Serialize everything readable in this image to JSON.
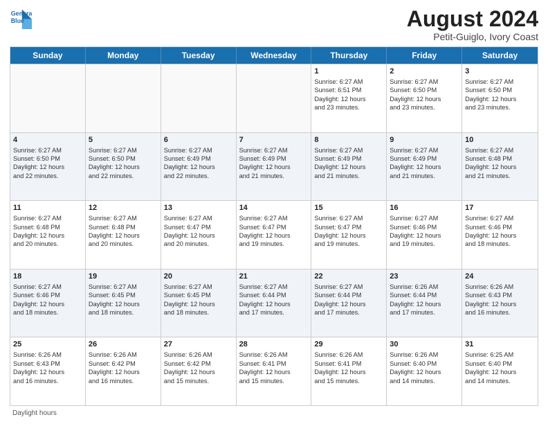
{
  "logo": {
    "line1": "General",
    "line2": "Blue"
  },
  "title": "August 2024",
  "subtitle": "Petit-Guiglo, Ivory Coast",
  "days_of_week": [
    "Sunday",
    "Monday",
    "Tuesday",
    "Wednesday",
    "Thursday",
    "Friday",
    "Saturday"
  ],
  "weeks": [
    [
      {
        "day": "",
        "info": ""
      },
      {
        "day": "",
        "info": ""
      },
      {
        "day": "",
        "info": ""
      },
      {
        "day": "",
        "info": ""
      },
      {
        "day": "1",
        "info": "Sunrise: 6:27 AM\nSunset: 6:51 PM\nDaylight: 12 hours\nand 23 minutes."
      },
      {
        "day": "2",
        "info": "Sunrise: 6:27 AM\nSunset: 6:50 PM\nDaylight: 12 hours\nand 23 minutes."
      },
      {
        "day": "3",
        "info": "Sunrise: 6:27 AM\nSunset: 6:50 PM\nDaylight: 12 hours\nand 23 minutes."
      }
    ],
    [
      {
        "day": "4",
        "info": "Sunrise: 6:27 AM\nSunset: 6:50 PM\nDaylight: 12 hours\nand 22 minutes."
      },
      {
        "day": "5",
        "info": "Sunrise: 6:27 AM\nSunset: 6:50 PM\nDaylight: 12 hours\nand 22 minutes."
      },
      {
        "day": "6",
        "info": "Sunrise: 6:27 AM\nSunset: 6:49 PM\nDaylight: 12 hours\nand 22 minutes."
      },
      {
        "day": "7",
        "info": "Sunrise: 6:27 AM\nSunset: 6:49 PM\nDaylight: 12 hours\nand 21 minutes."
      },
      {
        "day": "8",
        "info": "Sunrise: 6:27 AM\nSunset: 6:49 PM\nDaylight: 12 hours\nand 21 minutes."
      },
      {
        "day": "9",
        "info": "Sunrise: 6:27 AM\nSunset: 6:49 PM\nDaylight: 12 hours\nand 21 minutes."
      },
      {
        "day": "10",
        "info": "Sunrise: 6:27 AM\nSunset: 6:48 PM\nDaylight: 12 hours\nand 21 minutes."
      }
    ],
    [
      {
        "day": "11",
        "info": "Sunrise: 6:27 AM\nSunset: 6:48 PM\nDaylight: 12 hours\nand 20 minutes."
      },
      {
        "day": "12",
        "info": "Sunrise: 6:27 AM\nSunset: 6:48 PM\nDaylight: 12 hours\nand 20 minutes."
      },
      {
        "day": "13",
        "info": "Sunrise: 6:27 AM\nSunset: 6:47 PM\nDaylight: 12 hours\nand 20 minutes."
      },
      {
        "day": "14",
        "info": "Sunrise: 6:27 AM\nSunset: 6:47 PM\nDaylight: 12 hours\nand 19 minutes."
      },
      {
        "day": "15",
        "info": "Sunrise: 6:27 AM\nSunset: 6:47 PM\nDaylight: 12 hours\nand 19 minutes."
      },
      {
        "day": "16",
        "info": "Sunrise: 6:27 AM\nSunset: 6:46 PM\nDaylight: 12 hours\nand 19 minutes."
      },
      {
        "day": "17",
        "info": "Sunrise: 6:27 AM\nSunset: 6:46 PM\nDaylight: 12 hours\nand 18 minutes."
      }
    ],
    [
      {
        "day": "18",
        "info": "Sunrise: 6:27 AM\nSunset: 6:46 PM\nDaylight: 12 hours\nand 18 minutes."
      },
      {
        "day": "19",
        "info": "Sunrise: 6:27 AM\nSunset: 6:45 PM\nDaylight: 12 hours\nand 18 minutes."
      },
      {
        "day": "20",
        "info": "Sunrise: 6:27 AM\nSunset: 6:45 PM\nDaylight: 12 hours\nand 18 minutes."
      },
      {
        "day": "21",
        "info": "Sunrise: 6:27 AM\nSunset: 6:44 PM\nDaylight: 12 hours\nand 17 minutes."
      },
      {
        "day": "22",
        "info": "Sunrise: 6:27 AM\nSunset: 6:44 PM\nDaylight: 12 hours\nand 17 minutes."
      },
      {
        "day": "23",
        "info": "Sunrise: 6:26 AM\nSunset: 6:44 PM\nDaylight: 12 hours\nand 17 minutes."
      },
      {
        "day": "24",
        "info": "Sunrise: 6:26 AM\nSunset: 6:43 PM\nDaylight: 12 hours\nand 16 minutes."
      }
    ],
    [
      {
        "day": "25",
        "info": "Sunrise: 6:26 AM\nSunset: 6:43 PM\nDaylight: 12 hours\nand 16 minutes."
      },
      {
        "day": "26",
        "info": "Sunrise: 6:26 AM\nSunset: 6:42 PM\nDaylight: 12 hours\nand 16 minutes."
      },
      {
        "day": "27",
        "info": "Sunrise: 6:26 AM\nSunset: 6:42 PM\nDaylight: 12 hours\nand 15 minutes."
      },
      {
        "day": "28",
        "info": "Sunrise: 6:26 AM\nSunset: 6:41 PM\nDaylight: 12 hours\nand 15 minutes."
      },
      {
        "day": "29",
        "info": "Sunrise: 6:26 AM\nSunset: 6:41 PM\nDaylight: 12 hours\nand 15 minutes."
      },
      {
        "day": "30",
        "info": "Sunrise: 6:26 AM\nSunset: 6:40 PM\nDaylight: 12 hours\nand 14 minutes."
      },
      {
        "day": "31",
        "info": "Sunrise: 6:25 AM\nSunset: 6:40 PM\nDaylight: 12 hours\nand 14 minutes."
      }
    ]
  ],
  "legend": {
    "daylight": "Daylight hours"
  }
}
